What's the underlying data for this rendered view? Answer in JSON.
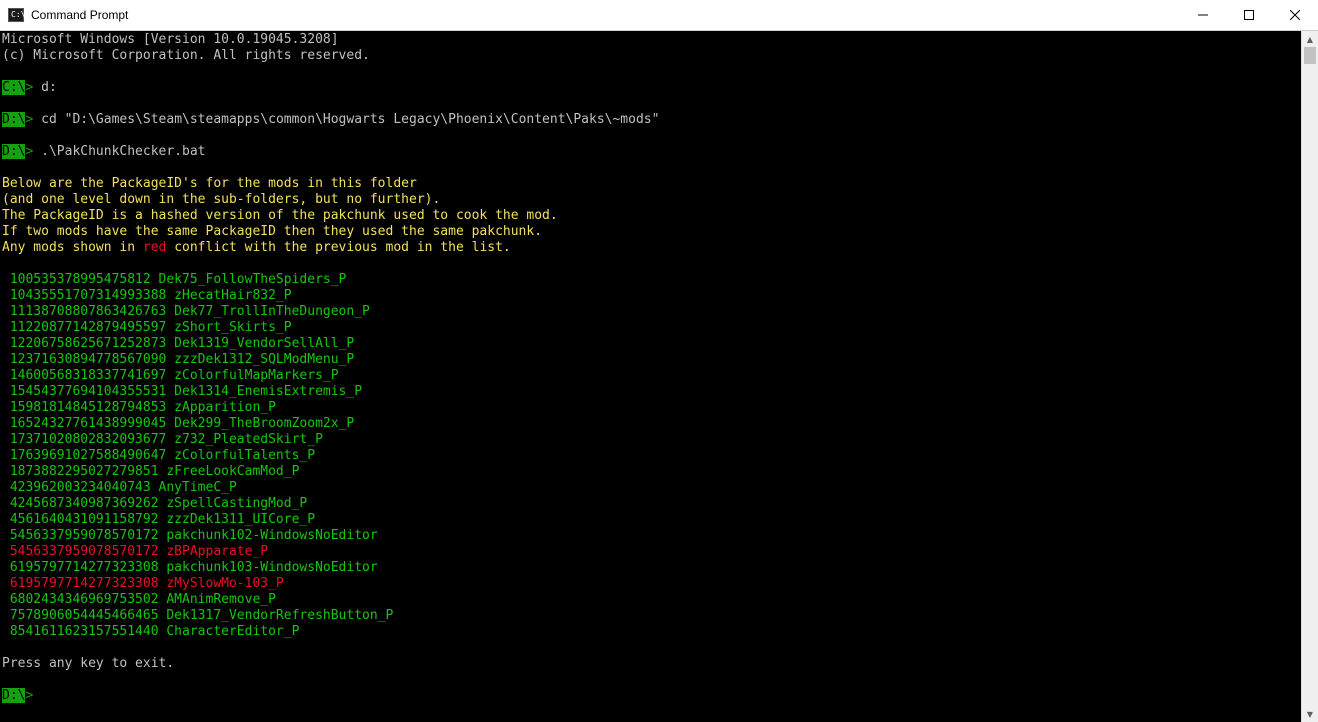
{
  "window": {
    "title": "Command Prompt",
    "icon_text": "C:\\",
    "controls": {
      "minimize": "minimize-icon",
      "maximize": "maximize-icon",
      "close": "close-icon"
    }
  },
  "colors": {
    "prompt_bg": "#13a10e",
    "yellow": "#f1e05a",
    "red": "#e81123",
    "green": "#16c60c",
    "gray": "#c0c0c0"
  },
  "console": {
    "header_1": "Microsoft Windows [Version 10.0.19045.3208]",
    "header_2": "(c) Microsoft Corporation. All rights reserved.",
    "prompt_c": "C:\\",
    "prompt_d": "D:\\",
    "arrow": ">",
    "cmd_1": " d:",
    "cmd_2": " cd \"D:\\Games\\Steam\\steamapps\\common\\Hogwarts Legacy\\Phoenix\\Content\\Paks\\~mods\"",
    "cmd_3": " .\\PakChunkChecker.bat",
    "info_1": "Below are the PackageID's for the mods in this folder",
    "info_2": "(and one level down in the sub-folders, but no further).",
    "info_3": "The PackageID is a hashed version of the pakchunk used to cook the mod.",
    "info_4": "If two mods have the same PackageID then they used the same pakchunk.",
    "info_5a": "Any mods shown in ",
    "info_5b": "red",
    "info_5c": " conflict with the previous mod in the list.",
    "mods": [
      {
        "text": " 10053537899547581​2 Dek75_FollowTheSpiders_P",
        "red": false
      }
    ],
    "exit_text": "Press any key to exit."
  }
}
